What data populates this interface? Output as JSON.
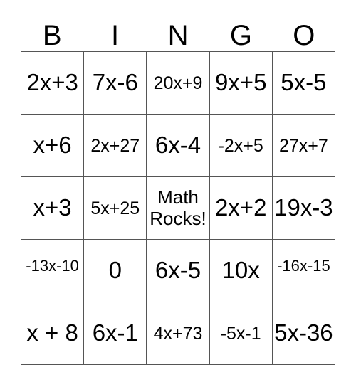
{
  "card": {
    "title": "Bingo Card",
    "header": {
      "letters": [
        "B",
        "I",
        "N",
        "G",
        "O"
      ]
    },
    "colors": {
      "background": "#ffffff",
      "border": "#555555",
      "text": "#000000"
    },
    "grid": {
      "columns": 5,
      "rows": 5,
      "free_space": {
        "row": 3,
        "column": 3,
        "label": "Math Rocks!"
      },
      "cells": [
        [
          {
            "text": "2x+3",
            "size": "lg"
          },
          {
            "text": "7x-6",
            "size": "lg"
          },
          {
            "text": "20x+9",
            "size": "md"
          },
          {
            "text": "9x+5",
            "size": "lg"
          },
          {
            "text": "5x-5",
            "size": "lg"
          }
        ],
        [
          {
            "text": "x+6",
            "size": "lg"
          },
          {
            "text": "2x+27",
            "size": "md"
          },
          {
            "text": "6x-4",
            "size": "lg"
          },
          {
            "text": "-2x+5",
            "size": "md"
          },
          {
            "text": "27x+7",
            "size": "md"
          }
        ],
        [
          {
            "text": "x+3",
            "size": "lg"
          },
          {
            "text": "5x+25",
            "size": "md"
          },
          {
            "text": "Math Rocks!",
            "size": "free"
          },
          {
            "text": "2x+2",
            "size": "lg"
          },
          {
            "text": "19x-3",
            "size": "lg"
          }
        ],
        [
          {
            "text": "-13x-10",
            "size": "sm"
          },
          {
            "text": "0",
            "size": "lg"
          },
          {
            "text": "6x-5",
            "size": "lg"
          },
          {
            "text": "10x",
            "size": "lg"
          },
          {
            "text": "-16x-15",
            "size": "sm"
          }
        ],
        [
          {
            "text": "x + 8",
            "size": "lg"
          },
          {
            "text": "6x-1",
            "size": "lg"
          },
          {
            "text": "4x+73",
            "size": "md"
          },
          {
            "text": "-5x-1",
            "size": "md"
          },
          {
            "text": "5x-36",
            "size": "lg"
          }
        ]
      ]
    }
  }
}
